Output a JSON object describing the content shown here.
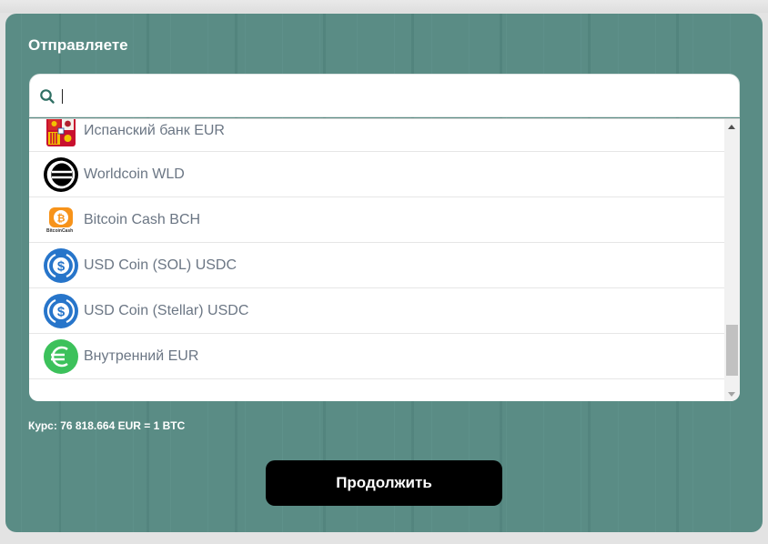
{
  "form": {
    "title": "Отправляете",
    "search": {
      "value": "",
      "placeholder": ""
    },
    "currencies": [
      {
        "label": "Испанский банк EUR",
        "icon": "spain-coat-of-arms-icon"
      },
      {
        "label": "Worldcoin WLD",
        "icon": "worldcoin-icon"
      },
      {
        "label": "Bitcoin Cash BCH",
        "icon": "bitcoin-cash-icon",
        "icon_caption": "BitcoinCash"
      },
      {
        "label": "USD Coin (SOL) USDC",
        "icon": "usdc-icon"
      },
      {
        "label": "USD Coin (Stellar) USDC",
        "icon": "usdc-icon"
      },
      {
        "label": "Внутренний EUR",
        "icon": "euro-icon"
      }
    ],
    "rate": {
      "label": "Курс:",
      "value": "76 818.664 EUR = 1 BTC"
    },
    "continue_label": "Продолжить"
  },
  "colors": {
    "card_bg": "#5a8c85",
    "button_bg": "#000000",
    "item_text": "#6b7684",
    "usdc_blue": "#2775ca",
    "euro_green": "#3cc15b",
    "bch_orange": "#f7931a"
  }
}
